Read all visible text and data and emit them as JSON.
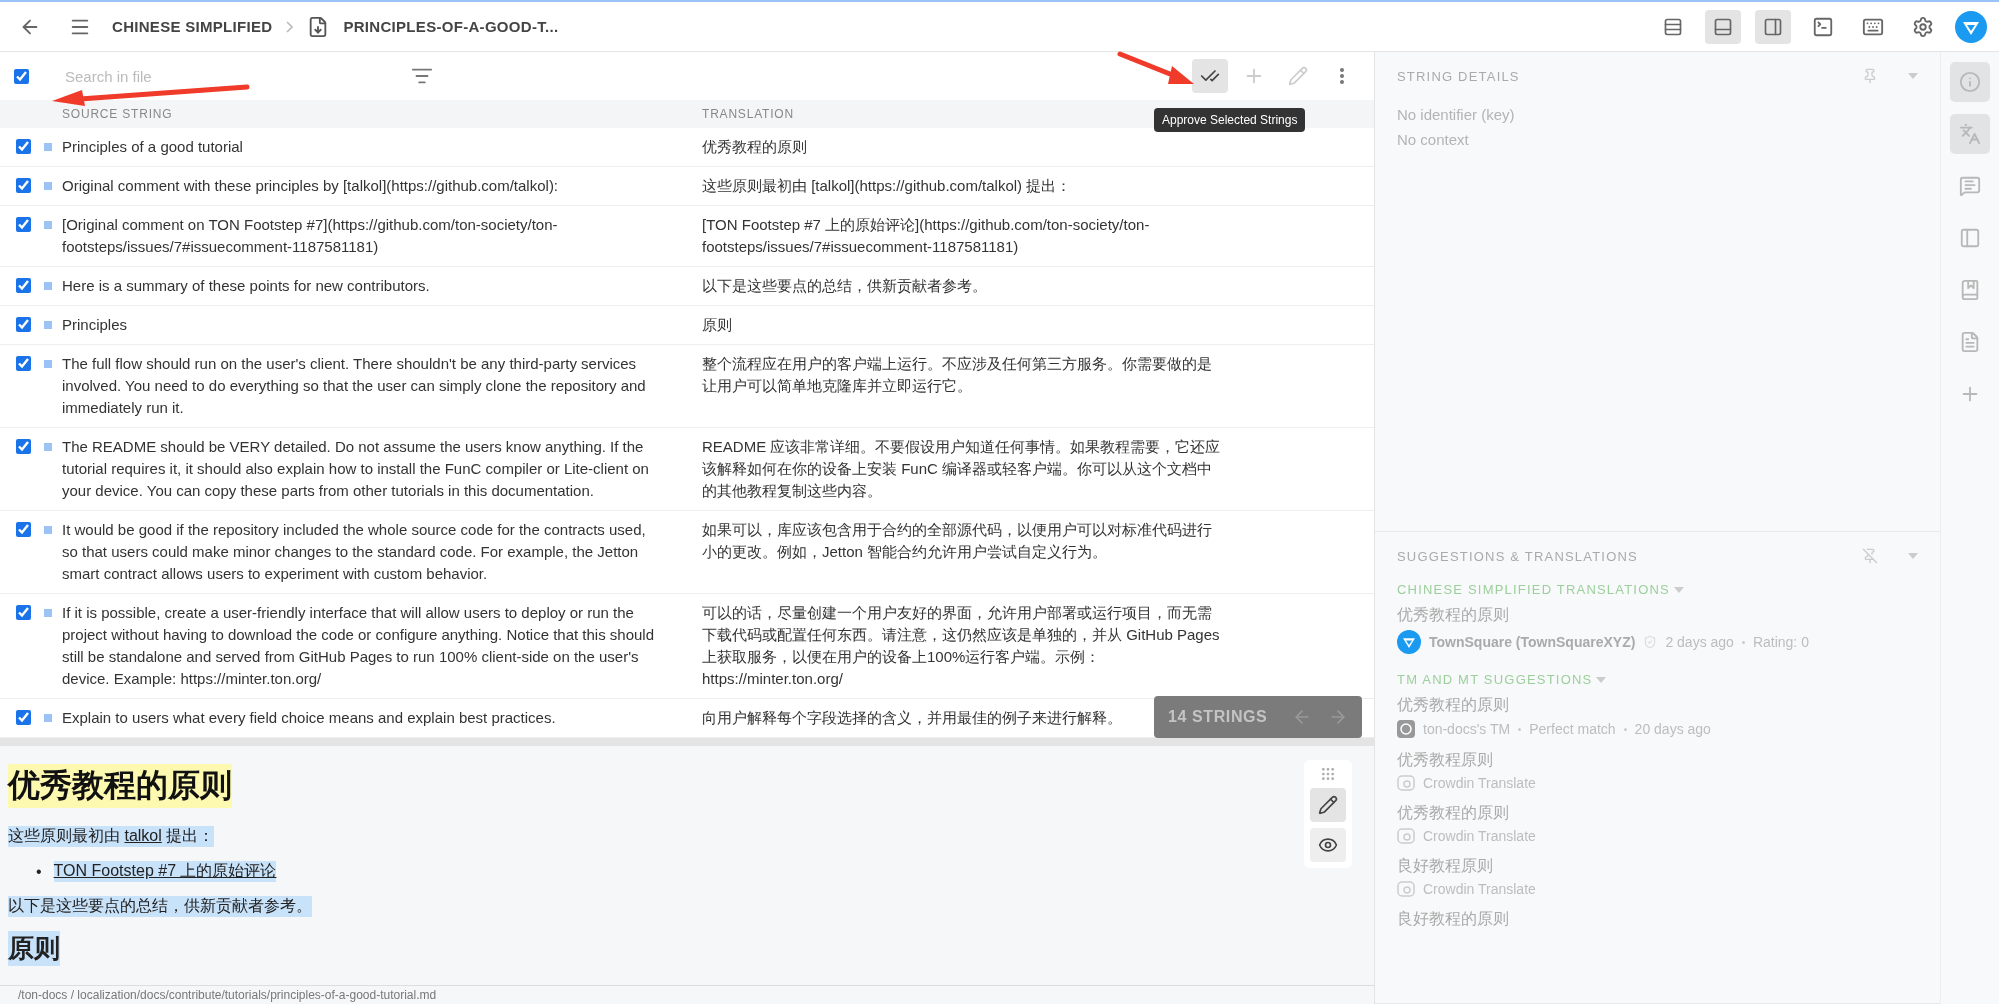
{
  "breadcrumb": {
    "language": "CHINESE SIMPLIFIED",
    "file": "PRINCIPLES-OF-A-GOOD-T..."
  },
  "view_toggles": [
    {
      "kind": "columns",
      "selected": false
    },
    {
      "kind": "bottom",
      "selected": true
    },
    {
      "kind": "right",
      "selected": true
    }
  ],
  "toolbar": {
    "select_all_checked": true,
    "search_placeholder": "Search in file",
    "tooltip": "Approve Selected Strings"
  },
  "table": {
    "columns": [
      "SOURCE STRING",
      "TRANSLATION"
    ],
    "rows": [
      {
        "checked": true,
        "source": "Principles of a good tutorial",
        "translation": "优秀教程的原则"
      },
      {
        "checked": true,
        "source": "Original comment with these principles by [talkol](https://github.com/talkol):",
        "translation": "这些原则最初由 [talkol](https://github.com/talkol) 提出："
      },
      {
        "checked": true,
        "source": "[Original comment on TON Footstep #7](https://github.com/ton-society/ton-footsteps/issues/7#issuecomment-1187581181)",
        "translation": "[TON Footstep #7 上的原始评论](https://github.com/ton-society/ton-footsteps/issues/7#issuecomment-1187581181)"
      },
      {
        "checked": true,
        "source": "Here is a summary of these points for new contributors.",
        "translation": "以下是这些要点的总结，供新贡献者参考。"
      },
      {
        "checked": true,
        "source": "Principles",
        "translation": "原则"
      },
      {
        "checked": true,
        "source": "The full flow should run on the user's client. There shouldn't be any third-party services involved. You need to do everything so that the user can simply clone the repository and immediately run it.",
        "translation": "整个流程应在用户的客户端上运行。不应涉及任何第三方服务。你需要做的是让用户可以简单地克隆库并立即运行它。"
      },
      {
        "checked": true,
        "source": "The README should be VERY detailed. Do not assume the users know anything. If the tutorial requires it, it should also explain how to install the FunC compiler or Lite-client on your device. You can copy these parts from other tutorials in this documentation.",
        "translation": "README 应该非常详细。不要假设用户知道任何事情。如果教程需要，它还应该解释如何在你的设备上安装 FunC 编译器或轻客户端。你可以从这个文档中的其他教程复制这些内容。"
      },
      {
        "checked": true,
        "source": "It would be good if the repository included the whole source code for the contracts used, so that users could make minor changes to the standard code. For example, the Jetton smart contract allows users to experiment with custom behavior.",
        "translation": "如果可以，库应该包含用于合约的全部源代码，以便用户可以对标准代码进行小的更改。例如，Jetton 智能合约允许用户尝试自定义行为。"
      },
      {
        "checked": true,
        "source": "If it is possible, create a user-friendly interface that will allow users to deploy or run the project without having to download the code or configure anything. Notice that this should still be standalone and served from GitHub Pages to run 100% client-side on the user's device. Example: https://minter.ton.org/",
        "translation": "可以的话，尽量创建一个用户友好的界面，允许用户部署或运行项目，而无需下载代码或配置任何东西。请注意，这仍然应该是单独的，并从 GitHub Pages 上获取服务，以便在用户的设备上100%运行客户端。示例：https://minter.ton.org/"
      },
      {
        "checked": true,
        "source": "Explain to users what every field choice means and explain best practices.",
        "translation": "向用户解释每个字段选择的含义，并用最佳的例子来进行解释。"
      }
    ]
  },
  "strings_counter": "14 STRINGS",
  "preview": {
    "title": "优秀教程的原则",
    "blocks": [
      {
        "kind": "paragraph",
        "parts": [
          {
            "kind": "text",
            "text": "这些原则最初由 "
          },
          {
            "kind": "link",
            "text": "talkol"
          },
          {
            "kind": "text",
            "text": " 提出："
          }
        ]
      },
      {
        "kind": "bullet",
        "marker": "•",
        "parts": [
          {
            "kind": "link",
            "text": "TON Footstep #7 上的原始评论"
          }
        ]
      },
      {
        "kind": "paragraph",
        "parts": [
          {
            "kind": "text",
            "text": "以下是这些要点的总结，供新贡献者参考。"
          }
        ]
      },
      {
        "kind": "heading",
        "parts": [
          {
            "kind": "text",
            "text": "原则"
          }
        ]
      }
    ],
    "edit_selected": true,
    "preview_selected": false
  },
  "file_path": "/ton-docs / localization/docs/contribute/tutorials/principles-of-a-good-tutorial.md",
  "string_details": {
    "title": "STRING DETAILS",
    "lines": [
      "No identifier (key)",
      "No context"
    ]
  },
  "suggestions": {
    "title": "SUGGESTIONS & TRANSLATIONS",
    "groups": [
      {
        "title": "CHINESE SIMPLIFIED TRANSLATIONS",
        "items": [
          {
            "kind": "translation",
            "text": "优秀教程的原则",
            "author": "TownSquare (TownSquareXYZ)",
            "meta": [
              "2 days ago",
              "Rating: 0"
            ]
          }
        ]
      },
      {
        "title": "TM AND MT SUGGESTIONS",
        "items": [
          {
            "kind": "tm",
            "text": "优秀教程的原则",
            "meta": [
              "ton-docs's TM",
              "Perfect match",
              "20 days ago"
            ]
          },
          {
            "kind": "mt",
            "text": "优秀教程原则",
            "meta": [
              "Crowdin Translate"
            ]
          },
          {
            "kind": "mt",
            "text": "优秀教程的原则",
            "meta": [
              "Crowdin Translate"
            ]
          },
          {
            "kind": "mt",
            "text": "良好教程原则",
            "meta": [
              "Crowdin Translate"
            ]
          },
          {
            "text": "良好教程的原则"
          }
        ]
      }
    ]
  },
  "rail": [
    {
      "kind": "info",
      "selected": true
    },
    {
      "kind": "translate",
      "selected": true
    },
    {
      "kind": "comments",
      "selected": false
    },
    {
      "kind": "panel",
      "selected": false
    },
    {
      "kind": "bookmarks",
      "selected": false
    },
    {
      "kind": "file-info",
      "selected": false
    },
    {
      "kind": "add",
      "selected": false
    }
  ]
}
